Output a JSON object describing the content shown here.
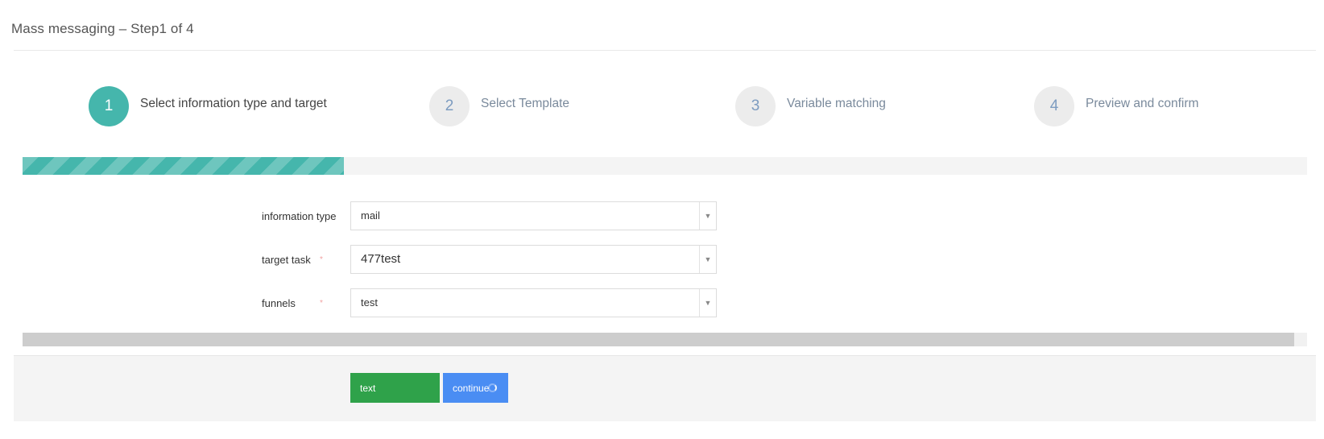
{
  "page": {
    "title": "Mass messaging – Step1 of 4"
  },
  "steps": [
    {
      "number": "1",
      "label": "Select information type and target",
      "active": true
    },
    {
      "number": "2",
      "label": "Select Template",
      "active": false
    },
    {
      "number": "3",
      "label": "Variable matching",
      "active": false
    },
    {
      "number": "4",
      "label": "Preview and confirm",
      "active": false
    }
  ],
  "progress": {
    "fraction": 0.25,
    "accent_color": "#45b6ac"
  },
  "form": {
    "information_type": {
      "label": "information type",
      "value": "mail"
    },
    "target_task": {
      "label": "target task",
      "required_mark": "*",
      "value": "477test"
    },
    "funnels": {
      "label": "funnels",
      "required_mark": "*",
      "value": "test"
    }
  },
  "icons": {
    "dropdown": "chevron-down-icon",
    "loading": "spinner-icon"
  },
  "footer": {
    "text_button_label": "text",
    "continue_button_label": "continue",
    "text_button_color": "#2fa24a",
    "continue_button_color": "#4a8df3"
  }
}
